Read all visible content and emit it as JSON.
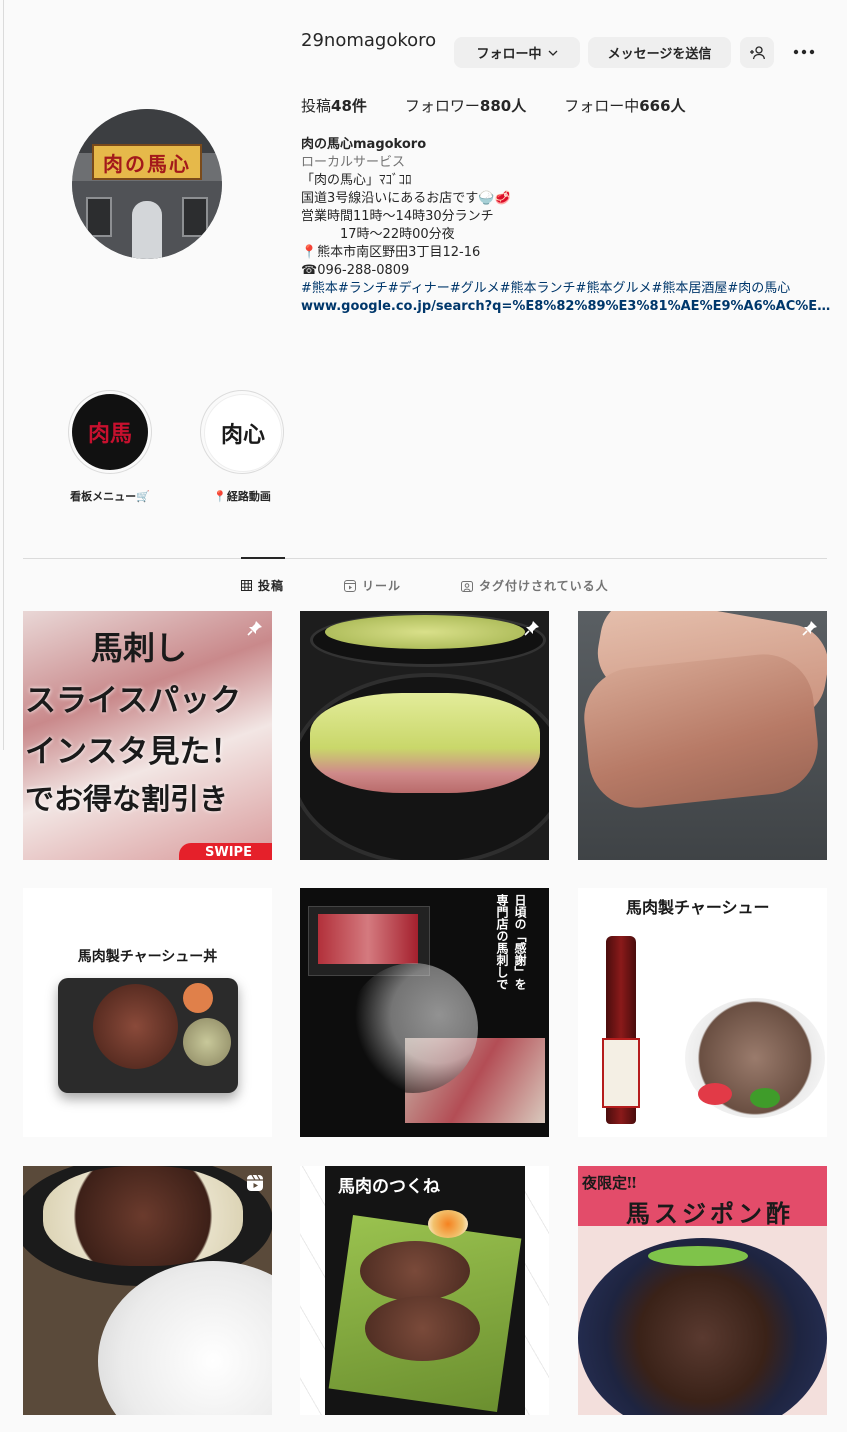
{
  "profile": {
    "username": "29nomagokoro",
    "follow_button": "フォロー中",
    "message_button": "メッセージを送信",
    "stats": [
      {
        "label": "投稿",
        "value": "48件"
      },
      {
        "label": "フォロワー",
        "value": "880人"
      },
      {
        "label": "フォロー中",
        "value": "666人"
      }
    ],
    "avatar_sign": "肉の馬心"
  },
  "bio": {
    "name": "肉の馬心magokoro",
    "category": "ローカルサービス",
    "lines": [
      "「肉の馬心」ﾏｺﾞｺﾛ",
      "国道3号線沿いにあるお店です🍚🥩",
      "営業時間11時〜14時30分ランチ",
      "　　　17時〜22時00分夜",
      "📍熊本市南区野田3丁目12-16",
      "☎096-288-0809"
    ],
    "hashtags": "#熊本#ランチ#ディナー#グルメ#熊本ランチ#熊本グルメ#熊本居酒屋#肉の馬心",
    "link": "www.google.co.jp/search?q=%E8%82%89%E3%81%AE%E9%A6%AC%E5..."
  },
  "highlights": [
    {
      "label": "看板メニュー🛒",
      "glyph": "肉馬"
    },
    {
      "label": "📍経路動画",
      "glyph": "肉心"
    }
  ],
  "tabs": [
    {
      "label": "投稿"
    },
    {
      "label": "リール"
    },
    {
      "label": "タグ付けされている人"
    }
  ],
  "posts": [
    {
      "caption_lines": [
        "馬刺し",
        "スライスパック",
        "インスタ見た！",
        "でお得な割引き"
      ],
      "badge": "SWIPE",
      "pinned": true
    },
    {
      "caption_lines": [],
      "pinned": true
    },
    {
      "caption_lines": [],
      "pinned": true
    },
    {
      "caption_lines": [
        "馬肉製チャーシュー丼"
      ]
    },
    {
      "caption_lines": [
        "日頃の「感謝」を",
        "専門店の馬刺しで"
      ]
    },
    {
      "caption_lines": [
        "馬肉製チャーシュー"
      ]
    },
    {
      "caption_lines": [],
      "reel": true
    },
    {
      "caption_lines": [
        "馬肉のつくね"
      ]
    },
    {
      "caption_lines": [
        "夜限定‼",
        "馬スジポン酢"
      ]
    }
  ],
  "colors": {
    "link": "#00376b",
    "muted": "#737373",
    "button_bg": "#efefef"
  }
}
